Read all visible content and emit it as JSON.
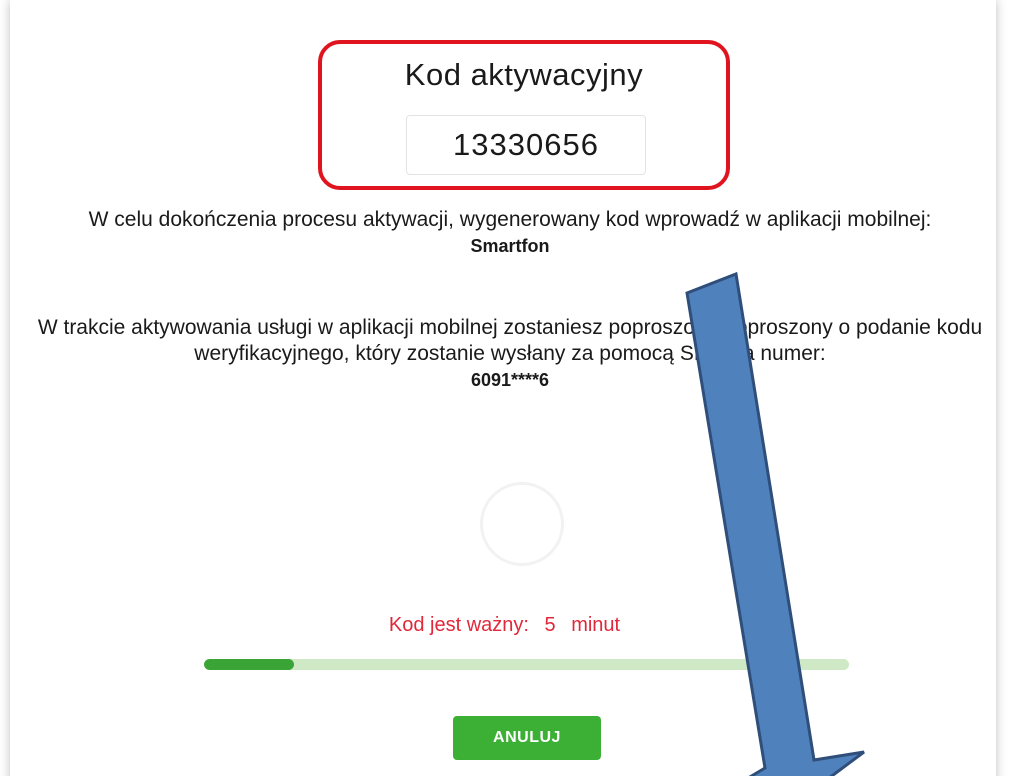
{
  "activation": {
    "title": "Kod aktywacyjny",
    "code": "13330656"
  },
  "instructions": {
    "text": "W celu dokończenia procesu aktywacji, wygenerowany kod wprowadź w aplikacji mobilnej:",
    "device": "Smartfon"
  },
  "sms_info": {
    "text": "W trakcie aktywowania usługi w aplikacji mobilnej zostaniesz poproszona/poproszony o podanie kodu weryfikacyjnego, który zostanie wysłany za pomocą SMS na numer:",
    "phone": "6091****6"
  },
  "validity": {
    "label": "Kod jest ważny:",
    "value": "5",
    "unit": "minut"
  },
  "progress": {
    "fraction": 0.14
  },
  "actions": {
    "cancel_label": "ANULUJ"
  },
  "colors": {
    "highlight_border": "#e0141e",
    "validity_text": "#e0283a",
    "button": "#3cb034",
    "progress_fill": "#3aa536",
    "progress_track": "#cfe8c6",
    "annotation_arrow": "#4f81bd"
  }
}
